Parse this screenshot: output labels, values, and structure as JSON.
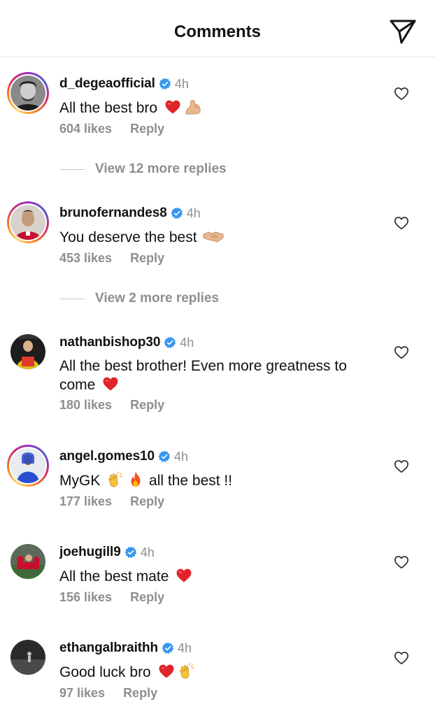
{
  "header": {
    "title": "Comments",
    "send_icon": "send-icon"
  },
  "colors": {
    "verified_blue": "#3897f0",
    "heart_red": "#e0242b",
    "muted_gray": "#8e8e8e"
  },
  "comments": [
    {
      "username": "d_degeaofficial",
      "verified": true,
      "time": "4h",
      "text": "All the best bro",
      "emojis": [
        "red-heart",
        "flexed-biceps"
      ],
      "likes": "604 likes",
      "reply_label": "Reply",
      "view_more": "View 12 more replies",
      "story_ring": true
    },
    {
      "username": "brunofernandes8",
      "verified": true,
      "time": "4h",
      "text": "You deserve the best",
      "emojis": [
        "handshake"
      ],
      "likes": "453 likes",
      "reply_label": "Reply",
      "view_more": "View 2 more replies",
      "story_ring": true
    },
    {
      "username": "nathanbishop30",
      "verified": true,
      "time": "4h",
      "text": "All the best brother! Even more greatness to come",
      "emojis": [
        "red-heart"
      ],
      "likes": "180 likes",
      "reply_label": "Reply",
      "story_ring": false
    },
    {
      "username": "angel.gomes10",
      "verified": true,
      "time": "4h",
      "text_before": "MyGK",
      "text_after": "all the best !!",
      "emojis": [
        "clapping-hands",
        "fire"
      ],
      "likes": "177 likes",
      "reply_label": "Reply",
      "story_ring": true
    },
    {
      "username": "joehugill9",
      "verified": true,
      "time": "4h",
      "text": "All the best mate",
      "emojis": [
        "red-heart"
      ],
      "likes": "156 likes",
      "reply_label": "Reply",
      "story_ring": false
    },
    {
      "username": "ethangalbraithh",
      "verified": true,
      "time": "4h",
      "text": "Good luck bro",
      "emojis": [
        "red-heart",
        "clapping-hands"
      ],
      "likes": "97 likes",
      "reply_label": "Reply",
      "story_ring": false
    }
  ]
}
